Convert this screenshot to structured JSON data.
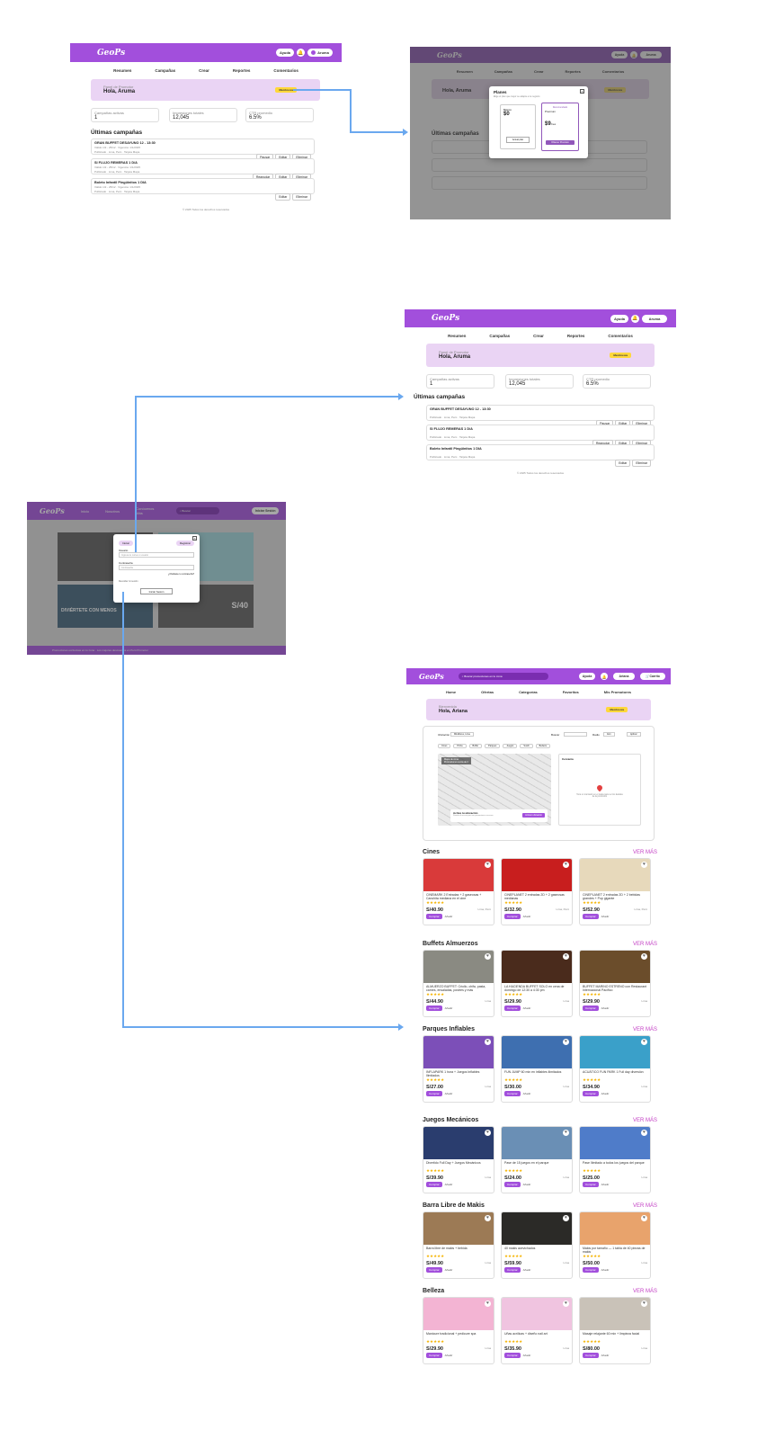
{
  "brand": {
    "logo": "GeoPs",
    "accent": "#a24fdc",
    "connector_color": "#6aa8ef"
  },
  "topbar": {
    "help": "Ayuda",
    "user": "Aruma",
    "notif_icon": "bell-icon"
  },
  "nav": [
    "Resumen",
    "Campañas",
    "Crear",
    "Reportes",
    "Comentarios"
  ],
  "dashboard": {
    "panel_label": "Panel de Promotor",
    "greeting": "Hola, Aruma",
    "badge": "Membresía",
    "stats": [
      {
        "label": "Campañas activas",
        "value": "1"
      },
      {
        "label": "Impresiones totales",
        "value": "12,045"
      },
      {
        "label": "CTR promedio",
        "value": "6.5%"
      }
    ],
    "section_title": "Últimas campañas",
    "campaigns": [
      {
        "name": "GRAN BUFFET DESAYUNO 12 - 13:30",
        "status": "Activa",
        "meta": "Válido 1/2 - 25/12 · Vigencia: 1/1/2025",
        "sub": "Publicado · Lima, Perú · Tarjeta Mapa",
        "actions": [
          "Pausar",
          "Editar",
          "Eliminar"
        ]
      },
      {
        "name": "SI FLUJO REMERAS 1 D/A",
        "status": "Pausada",
        "meta": "Válido 1/2 - 25/12 · Vigencia: 1/1/2025",
        "sub": "Publicado · Lima, Perú · Tarjeta Mapa",
        "actions": [
          "Reanudar",
          "Editar",
          "Eliminar"
        ]
      },
      {
        "name": "Boleto Infantil Pingüinitos 1 DIA",
        "status": "Borrador",
        "meta": "Válido 1/2 - 25/12 · Vigencia: 1/1/2025",
        "sub": "Publicado · Lima, Perú · Tarjeta Mapa",
        "actions": [
          "Editar",
          "Eliminar"
        ]
      }
    ],
    "footer": "© 2025 Todos los derechos reservados"
  },
  "planes_modal": {
    "title": "Planes",
    "subtitle": "Elige el plan que mejor se adapte a tu negocio",
    "free": {
      "name": "Básico",
      "price": "$0",
      "cta": "Actual plan"
    },
    "pro": {
      "name": "Premium",
      "tag": "Recomendado",
      "price": "$9",
      "period": "/mes",
      "cta": "Obtener Premium"
    }
  },
  "login_page": {
    "nav": [
      "Inicio",
      "Nosotros",
      "Conócenos Más"
    ],
    "search_placeholder": "Buscar",
    "login_button": "Iniciar Sesión",
    "banner_text": "DIVIÉRTETE CON MENOS",
    "banner_price": "S/40",
    "ticker": "Promociones exclusivas en tu zona · Los mejores descuentos en Perú Promotor",
    "modal": {
      "tab_login": "Iniciar",
      "tab_register": "Registrar",
      "user_label": "Usuario",
      "user_placeholder": "Ingresa tu correo o usuario",
      "pass_label": "Contraseña",
      "pass_placeholder": "Contraseña",
      "forgot": "¿Olvidaste tu contraseña?",
      "remember": "Recordar mi sesión",
      "submit": "Iniciar Sesión"
    }
  },
  "client_home": {
    "search_placeholder": "Buscar promociones en tu zona",
    "help": "Ayuda",
    "user": "Ariana",
    "cart": "Carrito",
    "nav": [
      "Home",
      "Ofertas",
      "Categorías",
      "Favoritos",
      "Mis Promotores"
    ],
    "greeting_label": "Bienvenida",
    "greeting": "Hola, Ariana",
    "badge": "Membresía",
    "filters": {
      "location_label": "Ubicación",
      "location_value": "Miraflores, Lima",
      "search_label": "Buscar",
      "radius_label": "Radio",
      "radius_value": "1km",
      "apply": "Aplicar"
    },
    "chips": [
      "Cines",
      "Pizza",
      "Buffet",
      "Parques",
      "Juegos",
      "Sushi",
      "Belleza"
    ],
    "map_card": {
      "title": "Mapa de zona",
      "subtitle": "Promociones cerca de ti",
      "prompt": "Activa tu ubicación",
      "hint": "Permite el acceso para ver promociones cercanas",
      "button": "Activar ubicación"
    },
    "detail_panel": {
      "title": "Cercanía",
      "empty": "Toca un marcador en el mapa para ver los detalles de la promoción"
    },
    "ver_mas": "VER MÁS",
    "categories": [
      {
        "title": "Cines",
        "cards": [
          {
            "title": "CINEMARK 2 Entradas + 2 gaseosas + Canchita mediana en el cine",
            "price": "S/40.90",
            "loc": "Lima, Perú",
            "color": "#d93a3a"
          },
          {
            "title": "CINEPLANET 2 entradas 2D + 2 gaseosas medianas",
            "price": "S/32.90",
            "loc": "Lima, Perú",
            "color": "#c81e1e"
          },
          {
            "title": "CINEPLANET 2 entradas 2D + 2 bebidas grandes + Pop gigante",
            "price": "S/52.90",
            "loc": "Lima, Perú",
            "color": "#e7d9bb"
          }
        ]
      },
      {
        "title": "Buffets Almuerzos",
        "cards": [
          {
            "title": "ALMUERZO BUFFET: Criollo, chifa, pasta, carnes, ensaladas, postres y más",
            "price": "S/44.90",
            "loc": "Lima",
            "color": "#8a8a82"
          },
          {
            "title": "LA HACIENDA BUFFET SOLO en cena de domingo de 12:30 a 4:30 pm",
            "price": "S/29.90",
            "loc": "Lima",
            "color": "#4a2b1c"
          },
          {
            "title": "BUFFET MARINO ESTRENO con Restaurant Internacional Pacífico",
            "price": "S/29.90",
            "loc": "Lima",
            "color": "#6b4d2b"
          }
        ]
      },
      {
        "title": "Parques Inflables",
        "cards": [
          {
            "title": "INFLAPARK 1 hora + Juegos Inflables Ilimitados",
            "price": "S/27.00",
            "loc": "Lima",
            "color": "#7c4fb8"
          },
          {
            "title": "FUN JUMP 60 min en inflables ilimitados",
            "price": "S/30.00",
            "loc": "Lima",
            "color": "#3e6fb0"
          },
          {
            "title": "ACUÁTICO FUN PARK 1 Full day diversión",
            "price": "S/34.90",
            "loc": "Lima",
            "color": "#3aa0c9"
          }
        ]
      },
      {
        "title": "Juegos Mecánicos",
        "cards": [
          {
            "title": "Divertido Full Day + Juegos Mecánicos",
            "price": "S/39.90",
            "loc": "Lima",
            "color": "#2a3d6e"
          },
          {
            "title": "Pase de 15 juegos en el parque",
            "price": "S/24.00",
            "loc": "Lima",
            "color": "#6a8fb5"
          },
          {
            "title": "Pase Ilimitado a todos los juegos del parque",
            "price": "S/25.00",
            "loc": "Lima",
            "color": "#4f7cc9"
          }
        ]
      },
      {
        "title": "Barra Libre de Makis",
        "cards": [
          {
            "title": "Barra libre de makis + bebida",
            "price": "S/49.90",
            "loc": "Lima",
            "color": "#9c7a55"
          },
          {
            "title": "40 makis acevichados",
            "price": "S/59.90",
            "loc": "Lima",
            "color": "#2b2a27"
          },
          {
            "title": "Makis por tamaño — 1 tabla de 40 piezas de makis",
            "price": "S/50.00",
            "loc": "Lima",
            "color": "#e8a36c"
          }
        ]
      },
      {
        "title": "Belleza",
        "cards": [
          {
            "title": "Manicure tradicional + pedicure spa",
            "price": "S/29.90",
            "loc": "Lima",
            "color": "#f3b4d3"
          },
          {
            "title": "Uñas acrílicas + diseño nail art",
            "price": "S/35.90",
            "loc": "Lima",
            "color": "#f0c4e0"
          },
          {
            "title": "Masaje relajante 60 min + limpieza facial",
            "price": "S/80.00",
            "loc": "Lima",
            "color": "#c9c2b8"
          }
        ]
      }
    ],
    "buy": "Comprar",
    "add": "Añadir"
  }
}
